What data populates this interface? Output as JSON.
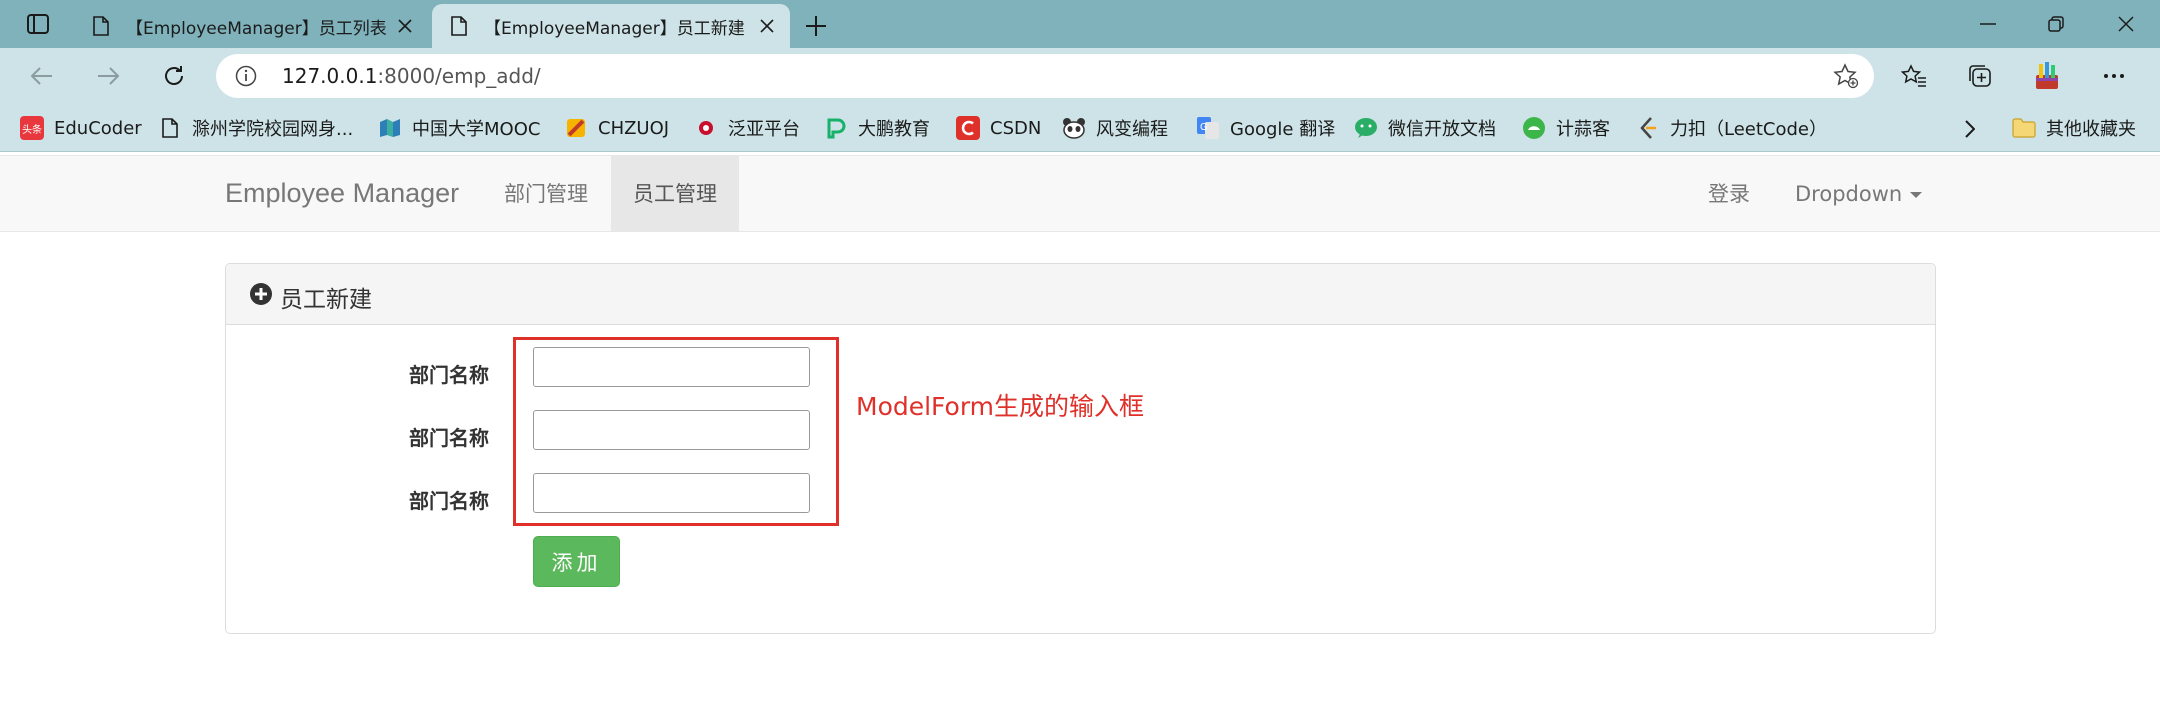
{
  "browser": {
    "tabs": [
      {
        "title": "【EmployeeManager】员工列表",
        "active": false
      },
      {
        "title": "【EmployeeManager】员工新建",
        "active": true
      }
    ],
    "url_host": "127.0.0.1",
    "url_rest": ":8000/emp_add/",
    "bookmarks": [
      {
        "label": "EduCoder",
        "icon": "toutiao-icon",
        "color": "#e8383d"
      },
      {
        "label": "滁州学院校园网身...",
        "icon": "page-icon",
        "color": "#555555"
      },
      {
        "label": "中国大学MOOC",
        "icon": "mooc-icon",
        "color": "#2e7fb7"
      },
      {
        "label": "CHZUOJ",
        "icon": "chzuoj-icon",
        "color": "#f6b400"
      },
      {
        "label": "泛亚平台",
        "icon": "fanya-icon",
        "color": "#c8102e"
      },
      {
        "label": "大鹏教育",
        "icon": "dapeng-icon",
        "color": "#17b26a"
      },
      {
        "label": "CSDN",
        "icon": "csdn-icon",
        "color": "#e0302a"
      },
      {
        "label": "风变编程",
        "icon": "panda-icon",
        "color": "#333333"
      },
      {
        "label": "Google 翻译",
        "icon": "google-translate-icon",
        "color": "#4285f4"
      },
      {
        "label": "微信开放文档",
        "icon": "wechat-icon",
        "color": "#2aae67"
      },
      {
        "label": "计蒜客",
        "icon": "jisuanke-icon",
        "color": "#3cb54a"
      },
      {
        "label": "力扣（LeetCode）",
        "icon": "leetcode-icon",
        "color": "#444444"
      }
    ],
    "other_bookmarks": "其他收藏夹"
  },
  "navbar": {
    "brand": "Employee Manager",
    "links": [
      "部门管理",
      "员工管理"
    ],
    "active_link": 1,
    "login": "登录",
    "dropdown": "Dropdown"
  },
  "panel": {
    "title": "员工新建",
    "fields": [
      {
        "label": "部门名称",
        "value": ""
      },
      {
        "label": "部门名称",
        "value": ""
      },
      {
        "label": "部门名称",
        "value": ""
      }
    ],
    "submit_label": "添加",
    "annotation": "ModelForm生成的输入框",
    "annotation_color": "#e0302a",
    "button_color": "#5cb85c"
  }
}
